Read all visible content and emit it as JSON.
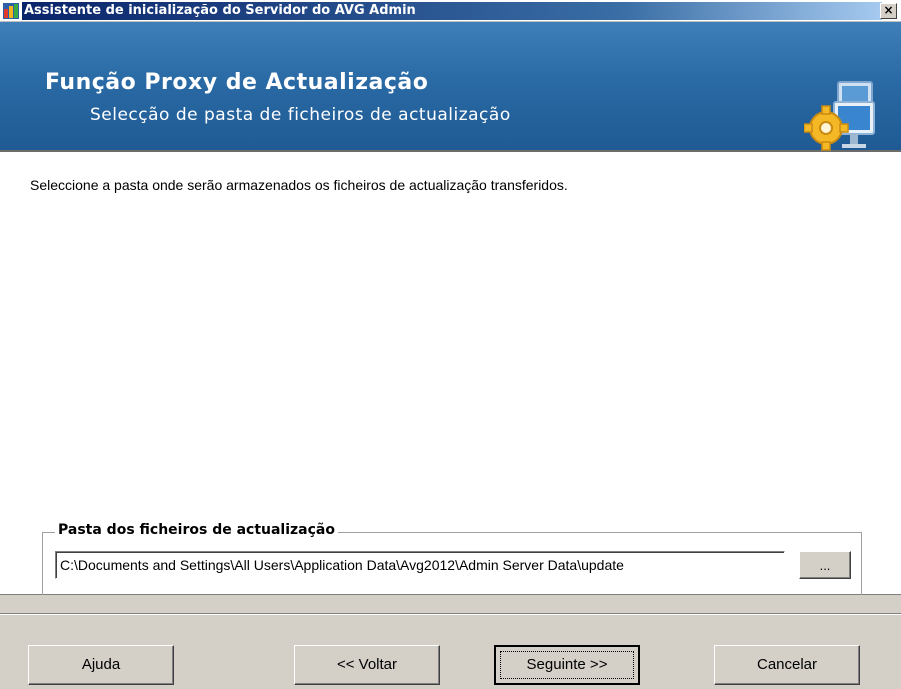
{
  "window": {
    "title": "Assistente de inicialização do Servidor do AVG Admin",
    "close_label": "×"
  },
  "banner": {
    "heading": "Função Proxy de Actualização",
    "subheading": "Selecção de pasta de ficheiros de actualização"
  },
  "content": {
    "instruction": "Seleccione a pasta onde serão armazenados os ficheiros de actualização transferidos.",
    "group": {
      "legend": "Pasta dos ficheiros de actualização",
      "path_value": "C:\\Documents and Settings\\All Users\\Application Data\\Avg2012\\Admin Server Data\\update",
      "browse_label": "..."
    }
  },
  "footer": {
    "help_label": "Ajuda",
    "back_label": "<< Voltar",
    "next_label": "Seguinte >>",
    "cancel_label": "Cancelar"
  },
  "icons": {
    "app": "avg-app-icon",
    "banner": "gear-computer-icon"
  },
  "colors": {
    "banner_blue": "#2a6aa5",
    "title_active": "#0a246a",
    "dialog_face": "#d4d0c8"
  }
}
